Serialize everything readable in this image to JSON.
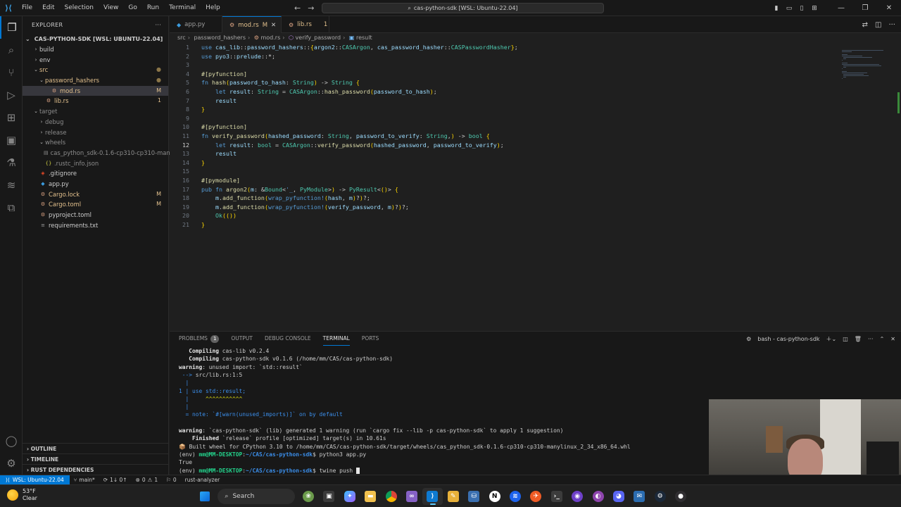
{
  "titlebar": {
    "menu": [
      "File",
      "Edit",
      "Selection",
      "View",
      "Go",
      "Run",
      "Terminal",
      "Help"
    ],
    "search_text": "cas-python-sdk [WSL: Ubuntu-22.04]"
  },
  "sidebar": {
    "title": "EXPLORER",
    "more": "···",
    "root": "CAS-PYTHON-SDK [WSL: UBUNTU-22.04]",
    "items": [
      {
        "label": "build",
        "depth": 1,
        "kind": "folder",
        "open": false,
        "badge": "",
        "color": "#cccccc"
      },
      {
        "label": "env",
        "depth": 1,
        "kind": "folder",
        "open": false,
        "badge": "",
        "color": "#cccccc"
      },
      {
        "label": "src",
        "depth": 1,
        "kind": "folder",
        "open": true,
        "badge": "●",
        "color": "#e2c08d"
      },
      {
        "label": "password_hashers",
        "depth": 2,
        "kind": "folder",
        "open": true,
        "badge": "●",
        "color": "#e2c08d"
      },
      {
        "label": "mod.rs",
        "depth": 3,
        "kind": "file",
        "open": false,
        "badge": "M",
        "color": "#e2c08d",
        "selected": true
      },
      {
        "label": "lib.rs",
        "depth": 2,
        "kind": "file",
        "open": false,
        "badge": "1",
        "color": "#e2c08d"
      },
      {
        "label": "target",
        "depth": 1,
        "kind": "folder",
        "open": true,
        "badge": "",
        "color": "#8c8c8c"
      },
      {
        "label": "debug",
        "depth": 2,
        "kind": "folder",
        "open": false,
        "badge": "",
        "color": "#8c8c8c"
      },
      {
        "label": "release",
        "depth": 2,
        "kind": "folder",
        "open": false,
        "badge": "",
        "color": "#8c8c8c"
      },
      {
        "label": "wheels",
        "depth": 2,
        "kind": "folder",
        "open": true,
        "badge": "",
        "color": "#8c8c8c"
      },
      {
        "label": "cas_python_sdk-0.1.6-cp310-cp310-manylin...",
        "depth": 3,
        "kind": "file",
        "open": false,
        "badge": "",
        "color": "#8c8c8c"
      },
      {
        "label": ".rustc_info.json",
        "depth": 2,
        "kind": "file",
        "open": false,
        "badge": "",
        "color": "#8c8c8c"
      },
      {
        "label": ".gitignore",
        "depth": 1,
        "kind": "file",
        "open": false,
        "badge": "",
        "color": "#cccccc"
      },
      {
        "label": "app.py",
        "depth": 1,
        "kind": "file",
        "open": false,
        "badge": "",
        "color": "#cccccc"
      },
      {
        "label": "Cargo.lock",
        "depth": 1,
        "kind": "file",
        "open": false,
        "badge": "M",
        "color": "#e2c08d"
      },
      {
        "label": "Cargo.toml",
        "depth": 1,
        "kind": "file",
        "open": false,
        "badge": "M",
        "color": "#e2c08d"
      },
      {
        "label": "pyproject.toml",
        "depth": 1,
        "kind": "file",
        "open": false,
        "badge": "",
        "color": "#cccccc"
      },
      {
        "label": "requirements.txt",
        "depth": 1,
        "kind": "file",
        "open": false,
        "badge": "",
        "color": "#cccccc"
      }
    ],
    "sections": [
      "OUTLINE",
      "TIMELINE",
      "RUST DEPENDENCIES"
    ]
  },
  "tabs": [
    {
      "label": "app.py",
      "modifier": "",
      "active": false
    },
    {
      "label": "mod.rs",
      "modifier": "M",
      "active": true
    },
    {
      "label": "lib.rs",
      "modifier": "1",
      "active": false
    }
  ],
  "breadcrumb": [
    "src",
    "password_hashers",
    "mod.rs",
    "verify_password",
    "result"
  ],
  "code": [
    "use cas_lib::password_hashers::{argon2::CASArgon, cas_password_hasher::CASPasswordHasher};",
    "use pyo3::prelude::*;",
    "",
    "#[pyfunction]",
    "fn hash(password_to_hash: String) -> String {",
    "    let result: String = CASArgon::hash_password(password_to_hash);",
    "    result",
    "}",
    "",
    "#[pyfunction]",
    "fn verify_password(hashed_password: String, password_to_verify: String,) -> bool {",
    "    let result: bool = CASArgon::verify_password(hashed_password, password_to_verify);",
    "    result",
    "}",
    "",
    "#[pymodule]",
    "pub fn argon2(m: &Bound<'_, PyModule>) -> PyResult<()> {",
    "    m.add_function(wrap_pyfunction!(hash, m)?)?;",
    "    m.add_function(wrap_pyfunction!(verify_password, m)?)?;",
    "    Ok(())",
    "}"
  ],
  "current_line": 12,
  "panel": {
    "tabs": [
      {
        "label": "PROBLEMS",
        "count": "1"
      },
      {
        "label": "OUTPUT",
        "count": ""
      },
      {
        "label": "DEBUG CONSOLE",
        "count": ""
      },
      {
        "label": "TERMINAL",
        "count": "",
        "active": true
      },
      {
        "label": "PORTS",
        "count": ""
      }
    ],
    "shell_label": "bash - cas-python-sdk"
  },
  "terminal": [
    "   Compiling cas-lib v0.2.4",
    "   Compiling cas-python-sdk v0.1.6 (/home/mm/CAS/cas-python-sdk)",
    "warning: unused import: `std::result`",
    " --> src/lib.rs:1:5",
    "  |",
    "1 | use std::result;",
    "  |     ^^^^^^^^^^^",
    "  |",
    "  = note: `#[warn(unused_imports)]` on by default",
    "",
    "warning: `cas-python-sdk` (lib) generated 1 warning (run `cargo fix --lib -p cas-python-sdk` to apply 1 suggestion)",
    "    Finished `release` profile [optimized] target(s) in 10.61s",
    "📦 Built wheel for CPython 3.10 to /home/mm/CAS/cas-python-sdk/target/wheels/cas_python_sdk-0.1.6-cp310-cp310-manylinux_2_34_x86_64.whl",
    "(env) mm@MM-DESKTOP:~/CAS/cas-python-sdk$ python3 app.py",
    "True",
    "(env) mm@MM-DESKTOP:~/CAS/cas-python-sdk$ twine push "
  ],
  "statusbar": {
    "remote": "WSL: Ubuntu-22.04",
    "branch": "main*",
    "sync": "1↓ 0↑",
    "errors": "0",
    "warnings": "1",
    "ports": "0",
    "extension": "rust-analyzer"
  },
  "taskbar": {
    "temp": "53°F",
    "weather": "Clear",
    "search": "Search"
  },
  "colors": {
    "accent": "#0078d4",
    "modified": "#e2c08d",
    "editor_bg": "#1f1f1f"
  }
}
